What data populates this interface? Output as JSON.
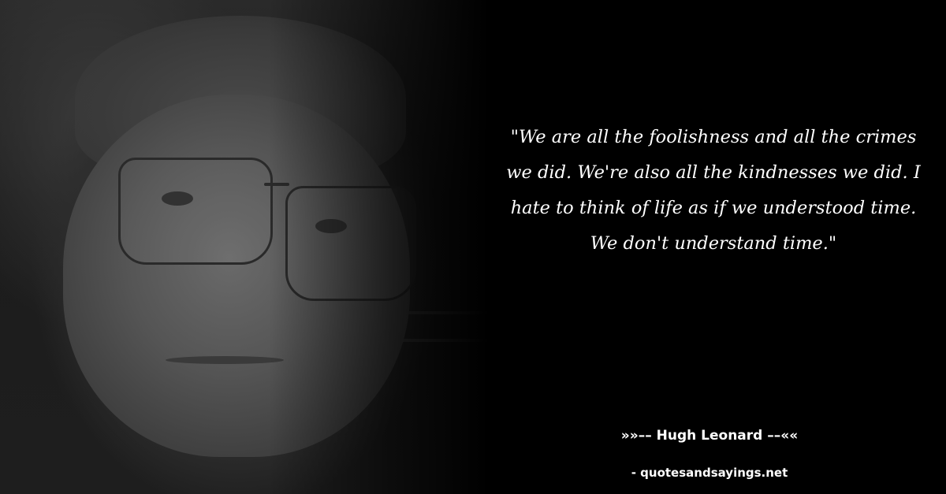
{
  "quote": {
    "text": "\"We are all the foolishness and all the crimes we did. We're also all the kindnesses we did. I hate to think of life as if we understood time. We don't understand time.\""
  },
  "author": {
    "line": "»»–– Hugh Leonard ––««"
  },
  "source": {
    "text": "- quotesandsayings.net"
  },
  "colors": {
    "background": "#000000",
    "text": "#ffffff"
  }
}
